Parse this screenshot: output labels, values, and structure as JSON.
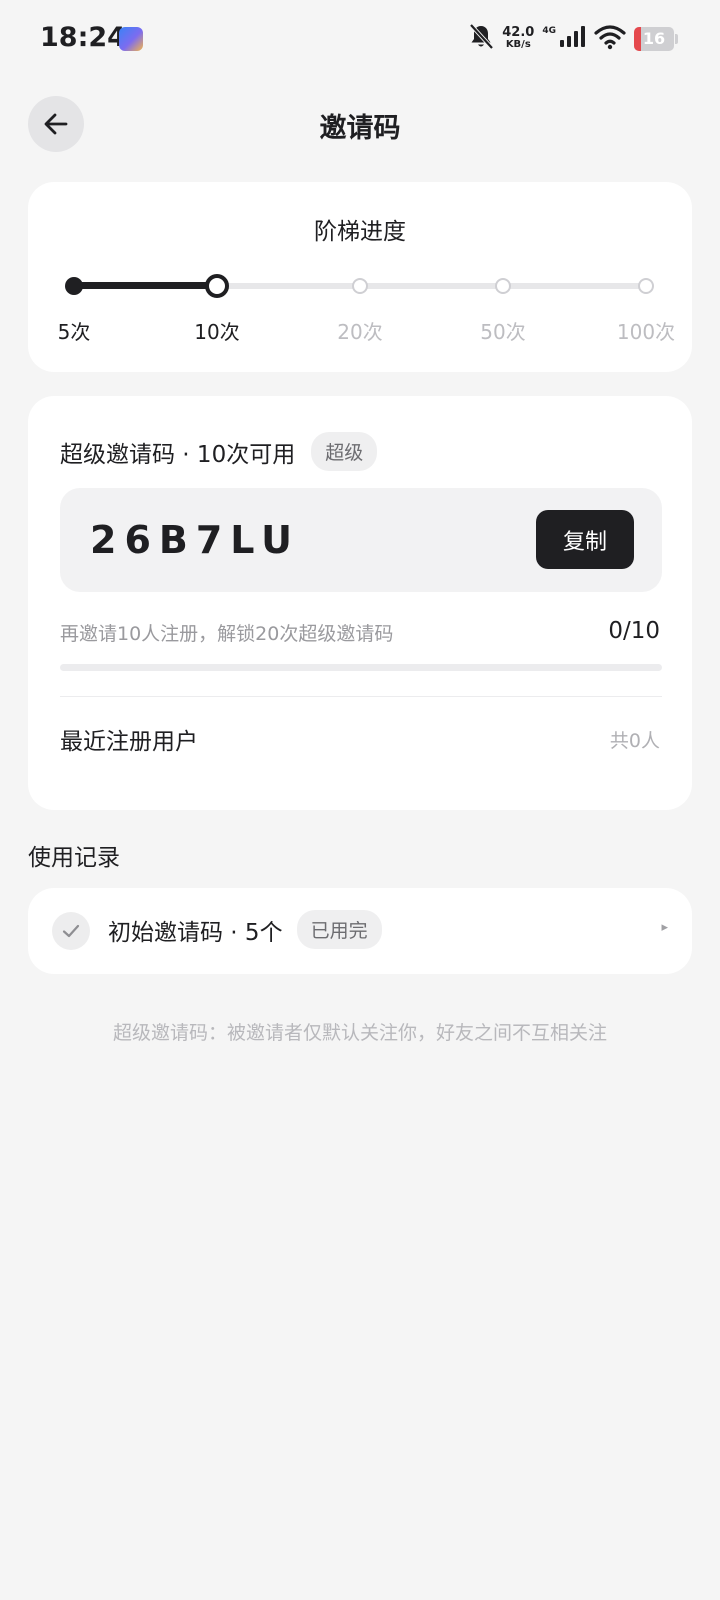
{
  "status_bar": {
    "time": "18:24",
    "net_speed_value": "42.0",
    "net_speed_unit": "KB/s",
    "network": "4G",
    "battery": "16",
    "icons": [
      "app-icon",
      "mute-bell-icon",
      "signal-icon",
      "wifi-icon",
      "battery-icon"
    ]
  },
  "header": {
    "title": "邀请码",
    "back_icon": "arrow-left-icon"
  },
  "ladder": {
    "title": "阶梯进度",
    "current_index": 1,
    "steps": [
      "5次",
      "10次",
      "20次",
      "50次",
      "100次"
    ]
  },
  "super_code": {
    "title": "超级邀请码 · 10次可用",
    "tag": "超级",
    "code": "26B7LU",
    "copy_label": "复制",
    "progress_text": "再邀请10人注册，解锁20次超级邀请码",
    "progress_count": "0/10",
    "progress_value": 0,
    "recent_title": "最近注册用户",
    "recent_count": "共0人"
  },
  "usage": {
    "title": "使用记录",
    "records": [
      {
        "label": "初始邀请码 · 5个",
        "status": "已用完",
        "icon": "check-icon"
      }
    ]
  },
  "footnote": "超级邀请码：被邀请者仅默认关注你，好友之间不互相关注",
  "colors": {
    "background": "#f5f5f5",
    "card": "#ffffff",
    "primary": "#1f1f22",
    "muted": "#9a9a9e",
    "battery_low": "#e5484d"
  }
}
